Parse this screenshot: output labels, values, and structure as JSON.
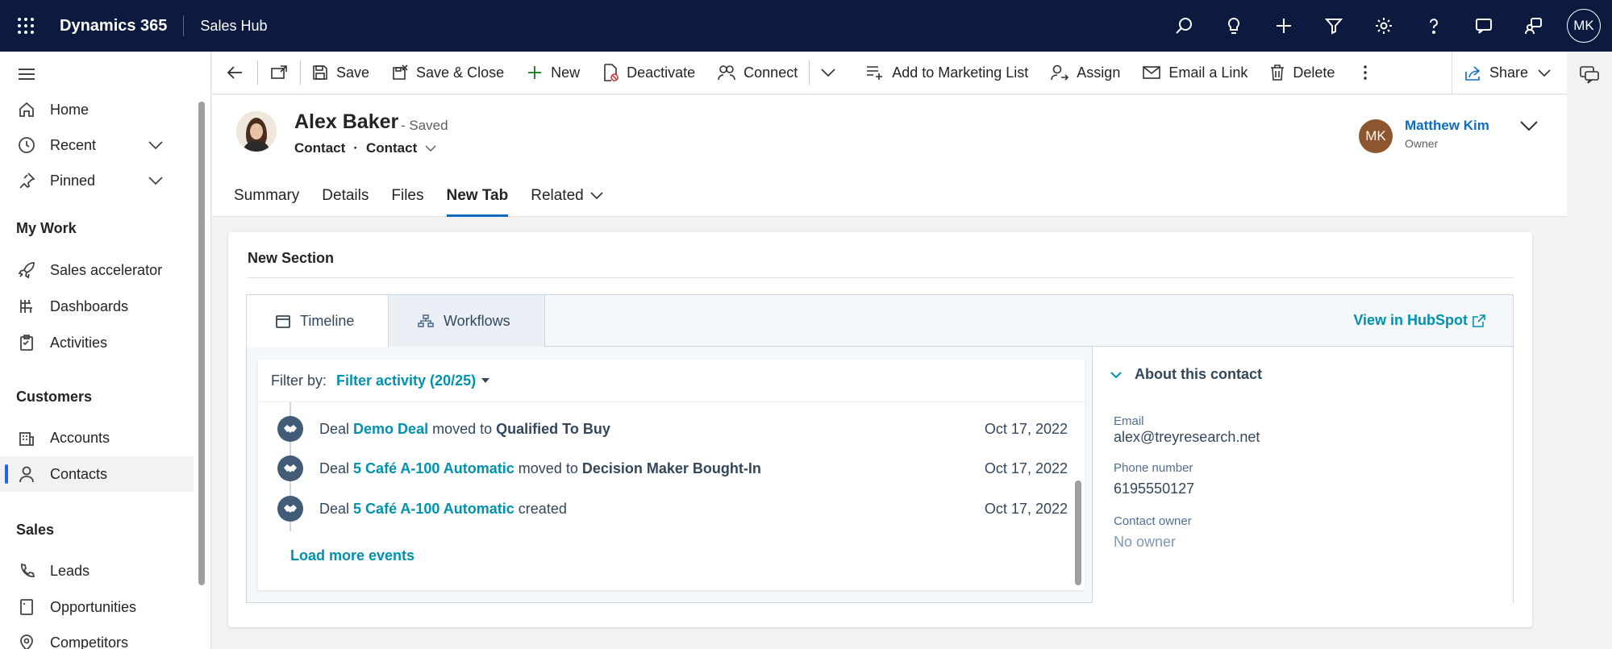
{
  "topbar": {
    "app_name": "Dynamics 365",
    "area": "Sales Hub",
    "user_initials": "MK",
    "icons": [
      "search-icon",
      "lightbulb-icon",
      "plus-icon",
      "filter-icon",
      "gear-icon",
      "help-icon",
      "chat-icon",
      "remote-assist-icon"
    ]
  },
  "sidebar": {
    "items": [
      {
        "label": "Home",
        "icon": "home-icon"
      },
      {
        "label": "Recent",
        "icon": "clock-icon"
      },
      {
        "label": "Pinned",
        "icon": "pin-icon"
      }
    ],
    "groups": {
      "my_work": {
        "title": "My Work",
        "items": [
          {
            "label": "Sales accelerator",
            "icon": "rocket-icon"
          },
          {
            "label": "Dashboards",
            "icon": "dashboard-icon"
          },
          {
            "label": "Activities",
            "icon": "clipboard-icon"
          }
        ]
      },
      "customers": {
        "title": "Customers",
        "items": [
          {
            "label": "Accounts",
            "icon": "building-icon"
          },
          {
            "label": "Contacts",
            "icon": "person-icon"
          }
        ]
      },
      "sales": {
        "title": "Sales",
        "items": [
          {
            "label": "Leads",
            "icon": "phone-icon"
          },
          {
            "label": "Opportunities",
            "icon": "document-icon"
          },
          {
            "label": "Competitors",
            "icon": "location-icon"
          }
        ]
      }
    }
  },
  "commandbar": {
    "save": "Save",
    "save_close": "Save & Close",
    "new": "New",
    "deactivate": "Deactivate",
    "connect": "Connect",
    "add_marketing": "Add to Marketing List",
    "assign": "Assign",
    "email_link": "Email a Link",
    "delete": "Delete",
    "share": "Share"
  },
  "record": {
    "name": "Alex Baker",
    "status": "- Saved",
    "entity": "Contact",
    "form": "Contact",
    "owner_initials": "MK",
    "owner_name": "Matthew Kim",
    "owner_role": "Owner"
  },
  "tabs": [
    "Summary",
    "Details",
    "Files",
    "New Tab",
    "Related"
  ],
  "section": {
    "title": "New Section"
  },
  "hubspot": {
    "tab_timeline": "Timeline",
    "tab_workflows": "Workflows",
    "view_link": "View in HubSpot",
    "filter_label": "Filter by:",
    "filter_value": "Filter activity (20/25)",
    "events": [
      {
        "prefix": "Deal",
        "deal": "Demo Deal",
        "verb": "moved to",
        "stage": "Qualified To Buy",
        "date": "Oct 17, 2022"
      },
      {
        "prefix": "Deal",
        "deal": "5 Café A-100 Automatic",
        "verb": "moved to",
        "stage": "Decision Maker Bought-In",
        "date": "Oct 17, 2022"
      },
      {
        "prefix": "Deal",
        "deal": "5 Café A-100 Automatic",
        "verb": "created",
        "stage": "",
        "date": "Oct 17, 2022"
      }
    ],
    "load_more": "Load more events",
    "about": {
      "title": "About this contact",
      "email_label": "Email",
      "email": "alex@treyresearch.net",
      "phone_label": "Phone number",
      "phone": "6195550127",
      "owner_label": "Contact owner",
      "owner": "No owner"
    }
  }
}
